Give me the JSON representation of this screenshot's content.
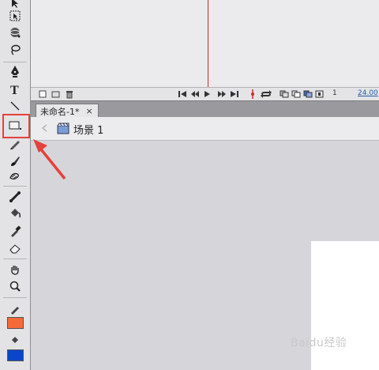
{
  "timeline": {
    "frame_number": "1",
    "fps": "24.00"
  },
  "document": {
    "tab_title": "未命名-1*",
    "tab_close": "×"
  },
  "editbar": {
    "scene_name": "场景 1"
  },
  "tools": [
    "selection-tool",
    "subselection-tool",
    "free-transform-tool",
    "3d-rotation-tool",
    "lasso-tool",
    "pen-tool",
    "text-tool",
    "line-tool",
    "rectangle-tool",
    "pencil-tool",
    "brush-tool",
    "deco-tool",
    "bone-tool",
    "paint-bucket-tool",
    "eyedropper-tool",
    "eraser-tool",
    "hand-tool",
    "zoom-tool",
    "stroke-color",
    "fill-color"
  ],
  "colors": {
    "stroke_swatch": "#f26b38",
    "fill_swatch": "#0a47c8",
    "highlight": "#e4413d",
    "playhead": "#d1282a"
  },
  "watermark": {
    "text": "Baidu经验"
  }
}
